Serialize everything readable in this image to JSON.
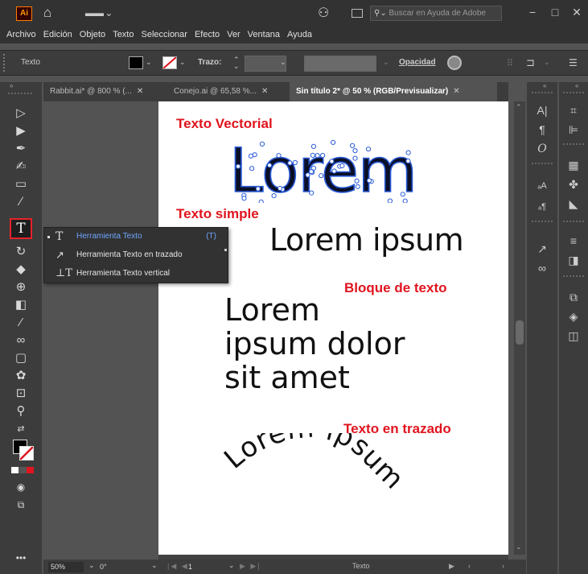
{
  "titlebar": {
    "app_logo": "Ai",
    "home_icon": "home-icon",
    "workspace_icon": "workspace-switcher-icon",
    "share_icon": "share-icon",
    "arrange_icon": "arrange-documents-icon",
    "help_search_placeholder": "Buscar en Ayuda de Adobe",
    "minimize": "−",
    "maximize": "□",
    "close": "✕"
  },
  "menu": [
    "Archivo",
    "Edición",
    "Objeto",
    "Texto",
    "Seleccionar",
    "Efecto",
    "Ver",
    "Ventana",
    "Ayuda"
  ],
  "controlbar": {
    "selection_label": "Texto",
    "stroke_label": "Trazo:",
    "opacity_label": "Opacidad",
    "fill_color": "#000000",
    "stroke_color": "#ffffff"
  },
  "tabs": [
    {
      "label": "Rabbit.ai* @ 800 % (...",
      "active": false
    },
    {
      "label": "Conejo.ai @ 65,58 %...",
      "active": false
    },
    {
      "label": "Sin título 2* @ 50 % (RGB/Previsualizar)",
      "active": true
    }
  ],
  "flyout": {
    "items": [
      {
        "label": "Herramienta Texto",
        "shortcut": "(T)",
        "icon": "type-tool-icon"
      },
      {
        "label": "Herramienta Texto en trazado",
        "shortcut": "",
        "icon": "type-on-path-tool-icon"
      },
      {
        "label": "Herramienta Texto vertical",
        "shortcut": "",
        "icon": "vertical-type-tool-icon"
      }
    ]
  },
  "artboard": {
    "label_vector": "Texto Vectorial",
    "vector_word": "Lorem",
    "label_simple": "Texto simple",
    "simple_text": "Lorem ipsum",
    "label_block": "Bloque de texto",
    "block_lines": [
      "Lorem",
      "ipsum dolor",
      "sit amet"
    ],
    "label_path": "Texto en trazado",
    "path_text": "Lorem ipsum"
  },
  "statusbar": {
    "zoom": "50%",
    "rotation": "0°",
    "artboard_number": "1",
    "tool_name": "Texto"
  },
  "colors": {
    "accent_red": "#e0141e",
    "selection_blue": "#2a5bd7",
    "highlight_blue": "#6fa7ff"
  }
}
